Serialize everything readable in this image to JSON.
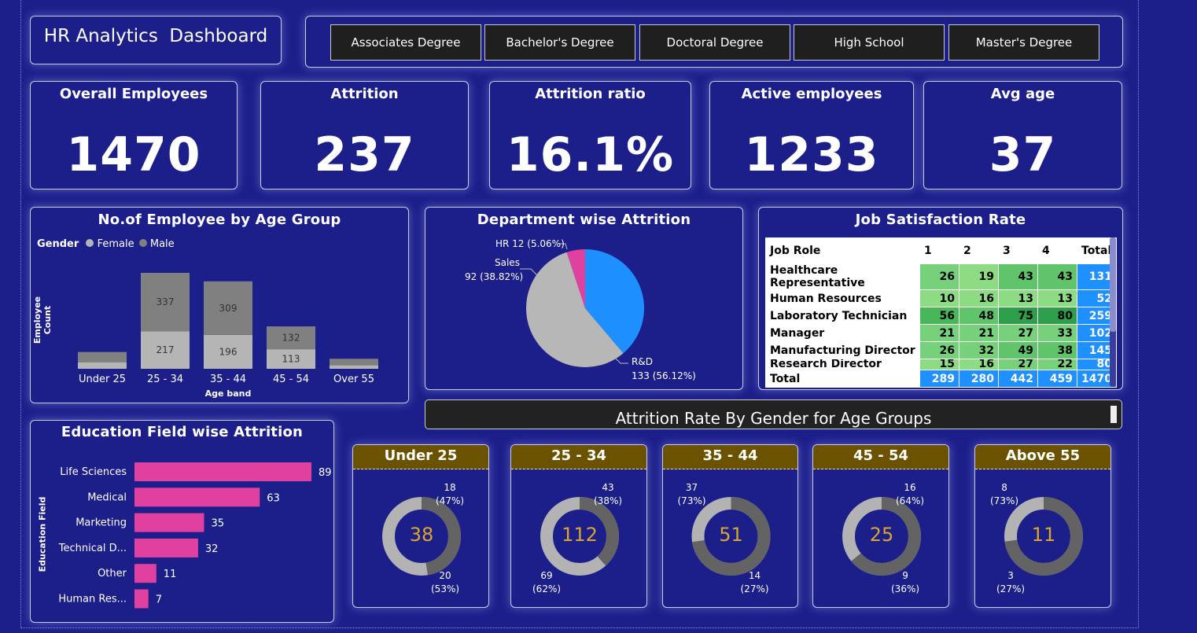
{
  "title": "HR Analytics  Dashboard",
  "slicer": [
    "Associates Degree",
    "Bachelor's Degree",
    "Doctoral Degree",
    "High School",
    "Master's Degree"
  ],
  "kpis": [
    {
      "label": "Overall Employees",
      "value": "1470"
    },
    {
      "label": "Attrition",
      "value": "237"
    },
    {
      "label": "Attrition ratio",
      "value": "16.1%"
    },
    {
      "label": "Active employees",
      "value": "1233"
    },
    {
      "label": "Avg age",
      "value": "37"
    }
  ],
  "age_chart": {
    "title": "No.of Employee by Age Group",
    "legend_title": "Gender",
    "legend": [
      "Female",
      "Male"
    ],
    "ylabel": "Employee Count",
    "xlabel": "Age band",
    "categories": [
      "Under 25",
      "25 - 34",
      "35 - 44",
      "45 - 54",
      "Over 55"
    ],
    "data_labels": {
      "female": [
        "",
        "217",
        "196",
        "113",
        ""
      ],
      "male": [
        "",
        "337",
        "309",
        "132",
        ""
      ]
    },
    "colors": {
      "female": "#b5b5b5",
      "male": "#808080"
    }
  },
  "dept_chart": {
    "title": "Department wise Attrition",
    "labels": [
      "HR 12 (5.06%)",
      "Sales",
      "92 (38.82%)",
      "R&D",
      "133 (56.12%)"
    ],
    "colors": {
      "hr": "#e040a0",
      "sales": "#1e8fff",
      "rnd": "#b7b7b7"
    }
  },
  "job_sat": {
    "title": "Job Satisfaction Rate",
    "headers": [
      "Job Role",
      "1",
      "2",
      "3",
      "4",
      "Total"
    ],
    "rows": [
      [
        "Healthcare Representative",
        "26",
        "19",
        "43",
        "43",
        "131"
      ],
      [
        "Human Resources",
        "10",
        "16",
        "13",
        "13",
        "52"
      ],
      [
        "Laboratory Technician",
        "56",
        "48",
        "75",
        "80",
        "259"
      ],
      [
        "Manager",
        "21",
        "21",
        "27",
        "33",
        "102"
      ],
      [
        "Manufacturing Director",
        "26",
        "32",
        "49",
        "38",
        "145"
      ],
      [
        "Research Director",
        "15",
        "16",
        "27",
        "22",
        "80"
      ]
    ],
    "total": [
      "Total",
      "289",
      "280",
      "442",
      "459",
      "1470"
    ]
  },
  "gender_banner": "Attrition Rate By Gender for Age Groups",
  "edu_chart": {
    "title": "Education Field wise Attrition",
    "ylabel": "Education Field",
    "color": "#e040a0",
    "categories": [
      "Life Sciences",
      "Medical",
      "Marketing",
      "Technical D...",
      "Other",
      "Human Res..."
    ],
    "values_text": [
      "89",
      "63",
      "35",
      "32",
      "11",
      "7"
    ]
  },
  "donuts": [
    {
      "title": "Under 25",
      "center": "38",
      "top_label": "18",
      "top_pct": "(47%)",
      "bot_label": "20",
      "bot_pct": "(53%)"
    },
    {
      "title": "25 - 34",
      "center": "112",
      "top_label": "43",
      "top_pct": "(38%)",
      "bot_label": "69",
      "bot_pct": "(62%)"
    },
    {
      "title": "35 - 44",
      "center": "51",
      "top_label": "37",
      "top_pct": "(73%)",
      "bot_label": "14",
      "bot_pct": "(27%)"
    },
    {
      "title": "45 - 54",
      "center": "25",
      "top_label": "16",
      "top_pct": "(64%)",
      "bot_label": "9",
      "bot_pct": "(36%)"
    },
    {
      "title": "Above 55",
      "center": "11",
      "top_label": "8",
      "top_pct": "(73%)",
      "bot_label": "3",
      "bot_pct": "(27%)"
    }
  ],
  "chart_data": [
    {
      "type": "bar",
      "title": "No.of Employee by Age Group",
      "xlabel": "Age band",
      "ylabel": "Employee Count",
      "categories": [
        "Under 25",
        "25 - 34",
        "35 - 44",
        "45 - 54",
        "Over 55"
      ],
      "series": [
        {
          "name": "Female",
          "values": [
            38,
            217,
            196,
            113,
            20
          ]
        },
        {
          "name": "Male",
          "values": [
            59,
            337,
            309,
            132,
            38
          ]
        }
      ]
    },
    {
      "type": "pie",
      "title": "Department wise Attrition",
      "categories": [
        "HR",
        "Sales",
        "R&D"
      ],
      "values": [
        12,
        92,
        133
      ]
    },
    {
      "type": "bar",
      "title": "Education Field wise Attrition",
      "ylabel": "Education Field",
      "categories": [
        "Life Sciences",
        "Medical",
        "Marketing",
        "Technical D...",
        "Other",
        "Human Res..."
      ],
      "values": [
        89,
        63,
        35,
        32,
        11,
        7
      ]
    },
    {
      "type": "pie",
      "title": "Under 25",
      "values": [
        18,
        20
      ]
    },
    {
      "type": "pie",
      "title": "25 - 34",
      "values": [
        43,
        69
      ]
    },
    {
      "type": "pie",
      "title": "35 - 44",
      "values": [
        37,
        14
      ]
    },
    {
      "type": "pie",
      "title": "45 - 54",
      "values": [
        16,
        9
      ]
    },
    {
      "type": "pie",
      "title": "Above 55",
      "values": [
        8,
        3
      ]
    }
  ]
}
